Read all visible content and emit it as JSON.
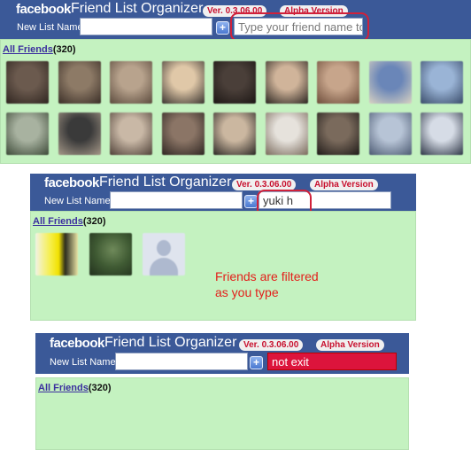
{
  "app": {
    "brand": "facebook",
    "title": "Friend List Organizer",
    "version_badge": "Ver. 0.3.06.00",
    "alpha_badge": "Alpha Version",
    "new_list_label": "New List Name"
  },
  "friends": {
    "link_label": "All Friends",
    "count": "(320)"
  },
  "states": [
    {
      "filter_text": "Type your friend name to",
      "filter_style": "placeholder"
    },
    {
      "filter_text": "yuki h",
      "filter_style": "typed"
    },
    {
      "filter_text": "not exit",
      "filter_style": "no-match"
    }
  ],
  "annotation": {
    "line1": "Friends are filtered",
    "line2": "as you type"
  },
  "colors": {
    "header": "#3b5998",
    "friends_area": "#c4f2c0",
    "highlight": "#d0213a",
    "badge_text": "#c8102e",
    "no_match_field": "#dc143c"
  }
}
